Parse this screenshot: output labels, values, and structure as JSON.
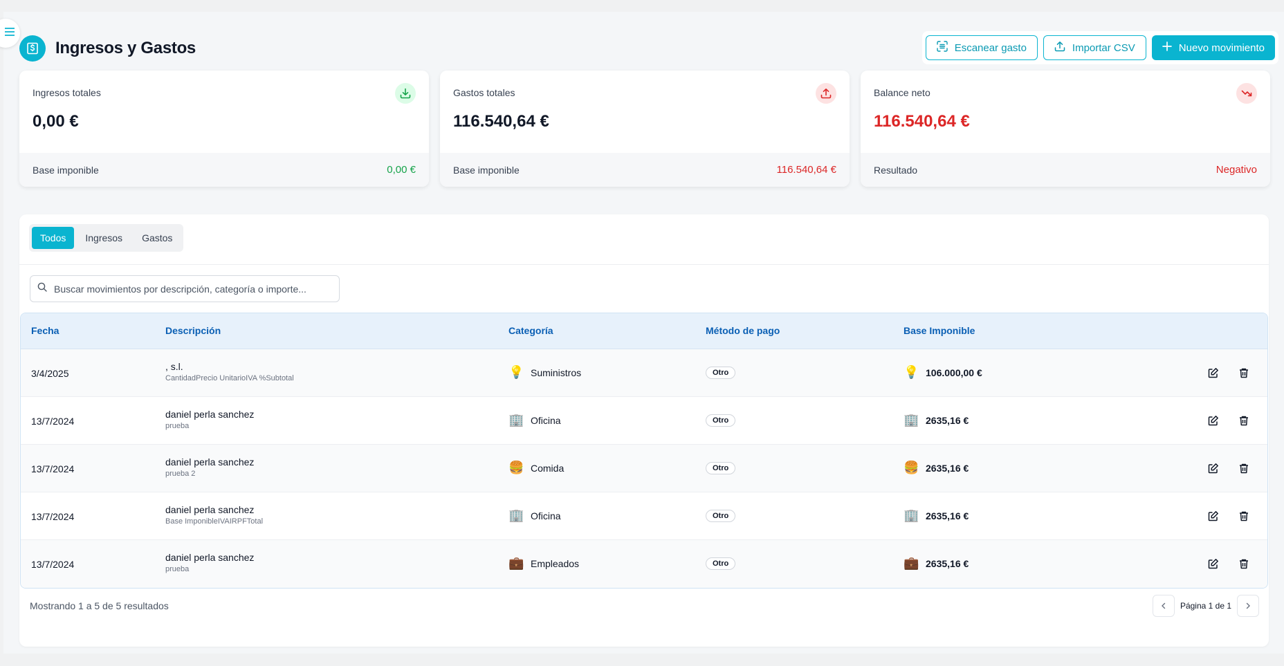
{
  "header": {
    "title": "Ingresos y Gastos",
    "actions": {
      "scan": "Escanear gasto",
      "import": "Importar CSV",
      "new": "Nuevo movimiento"
    }
  },
  "cards": [
    {
      "label": "Ingresos totales",
      "value": "0,00 €",
      "footer_label": "Base imponible",
      "footer_value": "0,00 €",
      "icon": "download-icon",
      "accent": "#16a34a"
    },
    {
      "label": "Gastos totales",
      "value": "116.540,64 €",
      "footer_label": "Base imponible",
      "footer_value": "116.540,64 €",
      "icon": "upload-icon",
      "accent": "#dc2626"
    },
    {
      "label": "Balance neto",
      "value": "116.540,64 €",
      "footer_label": "Resultado",
      "footer_value": "Negativo",
      "icon": "trending-down-icon",
      "accent": "#dc2626"
    }
  ],
  "tabs": [
    "Todos",
    "Ingresos",
    "Gastos"
  ],
  "search": {
    "placeholder": "Buscar movimientos por descripción, categoría o importe..."
  },
  "table": {
    "headers": [
      "Fecha",
      "Descripción",
      "Categoría",
      "Método de pago",
      "Base Imponible"
    ],
    "rows": [
      {
        "date": "3/4/2025",
        "title": ", s.l.",
        "subtitle": "CantidadPrecio UnitarioIVA %Subtotal",
        "category": "Suministros",
        "emoji": "💡",
        "payment": "Otro",
        "base": "106.000,00 €"
      },
      {
        "date": "13/7/2024",
        "title": "daniel perla sanchez",
        "subtitle": "prueba",
        "category": "Oficina",
        "emoji": "🏢",
        "payment": "Otro",
        "base": "2635,16 €"
      },
      {
        "date": "13/7/2024",
        "title": "daniel perla sanchez",
        "subtitle": "prueba 2",
        "category": "Comida",
        "emoji": "🍔",
        "payment": "Otro",
        "base": "2635,16 €"
      },
      {
        "date": "13/7/2024",
        "title": "daniel perla sanchez",
        "subtitle": "Base ImponibleIVAIRPFTotal",
        "category": "Oficina",
        "emoji": "🏢",
        "payment": "Otro",
        "base": "2635,16 €"
      },
      {
        "date": "13/7/2024",
        "title": "daniel perla sanchez",
        "subtitle": "prueba",
        "category": "Empleados",
        "emoji": "💼",
        "payment": "Otro",
        "base": "2635,16 €"
      }
    ]
  },
  "footer": {
    "results": "Mostrando 1 a 5 de 5 resultados",
    "page": "Página 1 de 1"
  },
  "colors": {
    "accent": "#0ab4d0",
    "positive": "#16a34a",
    "negative": "#dc2626",
    "header_text": "#0a5fb4"
  }
}
